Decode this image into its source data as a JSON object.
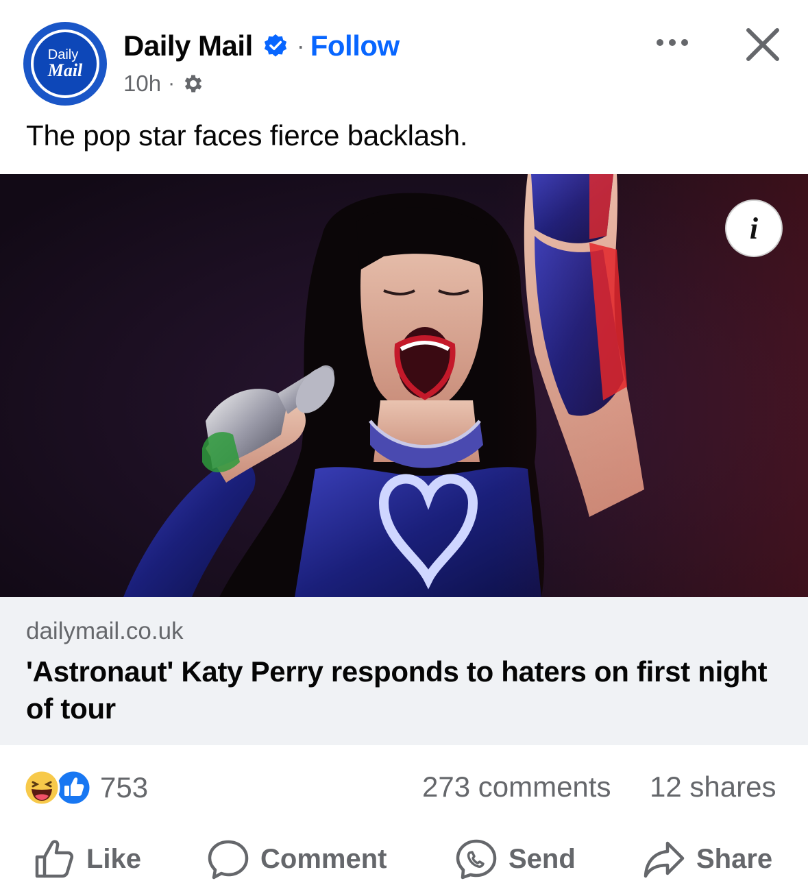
{
  "post": {
    "page_name": "Daily Mail",
    "avatar_text_line1": "Daily",
    "avatar_text_line2": "Mail",
    "separator": "·",
    "follow_label": "Follow",
    "time": "10h",
    "meta_separator": "·",
    "caption": "The pop star faces fierce backlash."
  },
  "link_preview": {
    "domain": "dailymail.co.uk",
    "headline": "'Astronaut' Katy Perry responds to haters on first night of tour"
  },
  "stats": {
    "reaction_count": "753",
    "comments": "273 comments",
    "shares": "12 shares"
  },
  "actions": {
    "like": "Like",
    "comment": "Comment",
    "send": "Send",
    "share": "Share"
  },
  "icons": {
    "verified": "verified-badge-icon",
    "privacy": "gear-icon",
    "more": "more-icon",
    "close": "close-icon",
    "info": "info-icon",
    "haha": "haha-reaction-icon",
    "like_reaction": "like-reaction-icon"
  },
  "colors": {
    "accent": "#0866ff",
    "secondary_text": "#65676b",
    "link_box_bg": "#f0f2f5",
    "photo_bg": "#170d1b"
  }
}
